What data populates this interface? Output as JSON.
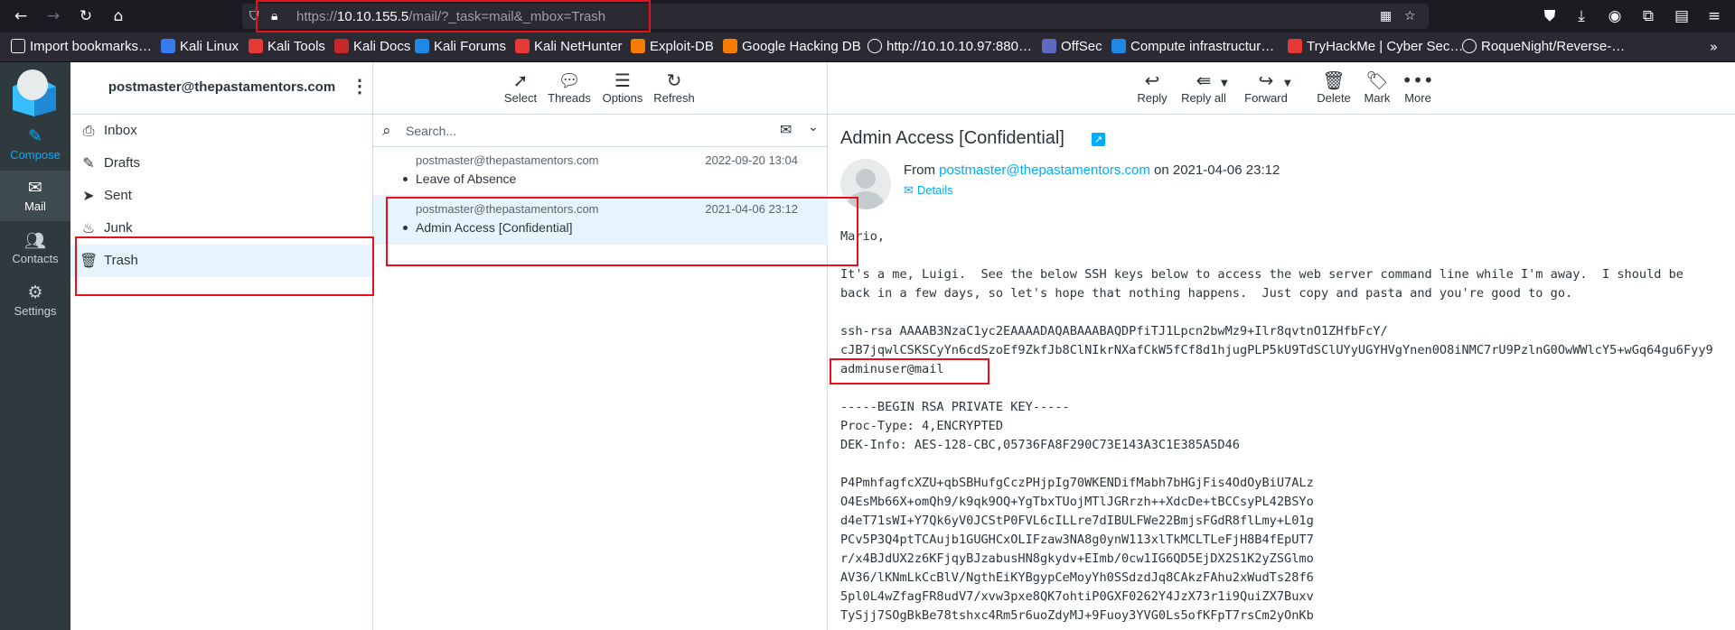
{
  "browser": {
    "url_prefix": "https://",
    "url_host": "10.10.155.5",
    "url_path": "/mail/?_task=mail&_mbox=Trash",
    "bookmarks": [
      {
        "label": "Import bookmarks…",
        "color": "#fbfbfe"
      },
      {
        "label": "Kali Linux",
        "color": "#367bf0"
      },
      {
        "label": "Kali Tools",
        "color": "#e53935"
      },
      {
        "label": "Kali Docs",
        "color": "#c62828"
      },
      {
        "label": "Kali Forums",
        "color": "#1e88e5"
      },
      {
        "label": "Kali NetHunter",
        "color": "#e53935"
      },
      {
        "label": "Exploit-DB",
        "color": "#f57c00"
      },
      {
        "label": "Google Hacking DB",
        "color": "#f57c00"
      },
      {
        "label": "http://10.10.10.97:880…",
        "color": "#fbfbfe"
      },
      {
        "label": "OffSec",
        "color": "#5c6bc0"
      },
      {
        "label": "Compute infrastructur…",
        "color": "#1e88e5"
      },
      {
        "label": "TryHackMe | Cyber Sec…",
        "color": "#e53935"
      },
      {
        "label": "RoqueNight/Reverse-…",
        "color": "#fbfbfe"
      }
    ]
  },
  "taskmenu": {
    "compose": "Compose",
    "mail": "Mail",
    "contacts": "Contacts",
    "settings": "Settings"
  },
  "sidebar": {
    "account": "postmaster@thepastamentors.com",
    "folders": [
      {
        "label": "Inbox",
        "icon": "inbox-icon"
      },
      {
        "label": "Drafts",
        "icon": "pencil-icon"
      },
      {
        "label": "Sent",
        "icon": "paper-plane-icon"
      },
      {
        "label": "Junk",
        "icon": "fire-icon"
      },
      {
        "label": "Trash",
        "icon": "trash-icon"
      }
    ]
  },
  "list_toolbar": {
    "select": "Select",
    "threads": "Threads",
    "options": "Options",
    "refresh": "Refresh"
  },
  "search": {
    "placeholder": "Search..."
  },
  "messages": [
    {
      "from": "postmaster@thepastamentors.com",
      "date": "2022-09-20 13:04",
      "subject": "Leave of Absence"
    },
    {
      "from": "postmaster@thepastamentors.com",
      "date": "2021-04-06 23:12",
      "subject": "Admin Access [Confidential]"
    }
  ],
  "content_toolbar": {
    "reply": "Reply",
    "reply_all": "Reply all",
    "forward": "Forward",
    "delete": "Delete",
    "mark": "Mark",
    "more": "More"
  },
  "message": {
    "subject": "Admin Access [Confidential]",
    "from_prefix": "From",
    "from_address": "postmaster@thepastamentors.com",
    "date_text": "on 2021-04-06 23:12",
    "details": "Details",
    "body": "Mario,\n\nIt's a me, Luigi.  See the below SSH keys below to access the web server command line while I'm away.  I should be\nback in a few days, so let's hope that nothing happens.  Just copy and pasta and you're good to go.\n\nssh-rsa AAAAB3NzaC1yc2EAAAADAQABAAABAQDPfiTJ1Lpcn2bwMz9+Ilr8qvtnO1ZHfbFcY/\ncJB7jqwlCSKSCyYn6cdSzoEf9ZkfJb8ClNIkrNXafCkW5fCf8d1hjugPLP5kU9TdSClUYyUGYHVgYnen0O8iNMC7rU9PzlnG0OwWWlcY5+wGq64gu6Fyy9\nadminuser@mail\n\n-----BEGIN RSA PRIVATE KEY-----\nProc-Type: 4,ENCRYPTED\nDEK-Info: AES-128-CBC,05736FA8F290C73E143A3C1E385A5D46\n\nP4PmhfagfcXZU+qbSBHufgCczPHjpIg70WKENDifMabh7bHGjFis4OdOyBiU7ALz\nO4EsMb66X+omQh9/k9qk9OQ+YgTbxTUojMTlJGRrzh++XdcDe+tBCCsyPL42BSYo\nd4eT71sWI+Y7Qk6yV0JCStP0FVL6cILLre7dIBULFWe22BmjsFGdR8flLmy+L01g\nPCv5P3Q4ptTCAujb1GUGHCxOLIFzaw3NA8g0ynW113xlTkMCLTLeFjH8B4fEpUT7\nr/x4BJdUX2z6KFjqyBJzabusHN8gkydv+EImb/0cw1IG6QD5EjDX2S1K2yZSGlmo\nAV36/lKNmLkCcBlV/NgthEiKYBgypCeMoyYh0SSdzdJq8CAkzFAhu2xWudTs28f6\n5pl0L4wZfagFR8udV7/xvw3pxe8QK7ohtiP0GXF0262Y4JzX73r1i9QuiZX7Buxv\nTySjj7SOgBkBe78tshxc4Rm5r6uoZdyMJ+9Fuoy3YVG0Ls5ofKFpT7rsCm2yOnKb"
  }
}
